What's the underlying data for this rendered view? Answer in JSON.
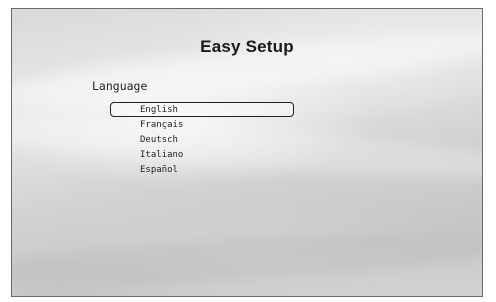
{
  "screen": {
    "title": "Easy Setup"
  },
  "language_menu": {
    "label": "Language",
    "selected_index": 0,
    "options": [
      {
        "label": "English"
      },
      {
        "label": "Français"
      },
      {
        "label": "Deutsch"
      },
      {
        "label": "Italiano"
      },
      {
        "label": "Español"
      }
    ]
  }
}
